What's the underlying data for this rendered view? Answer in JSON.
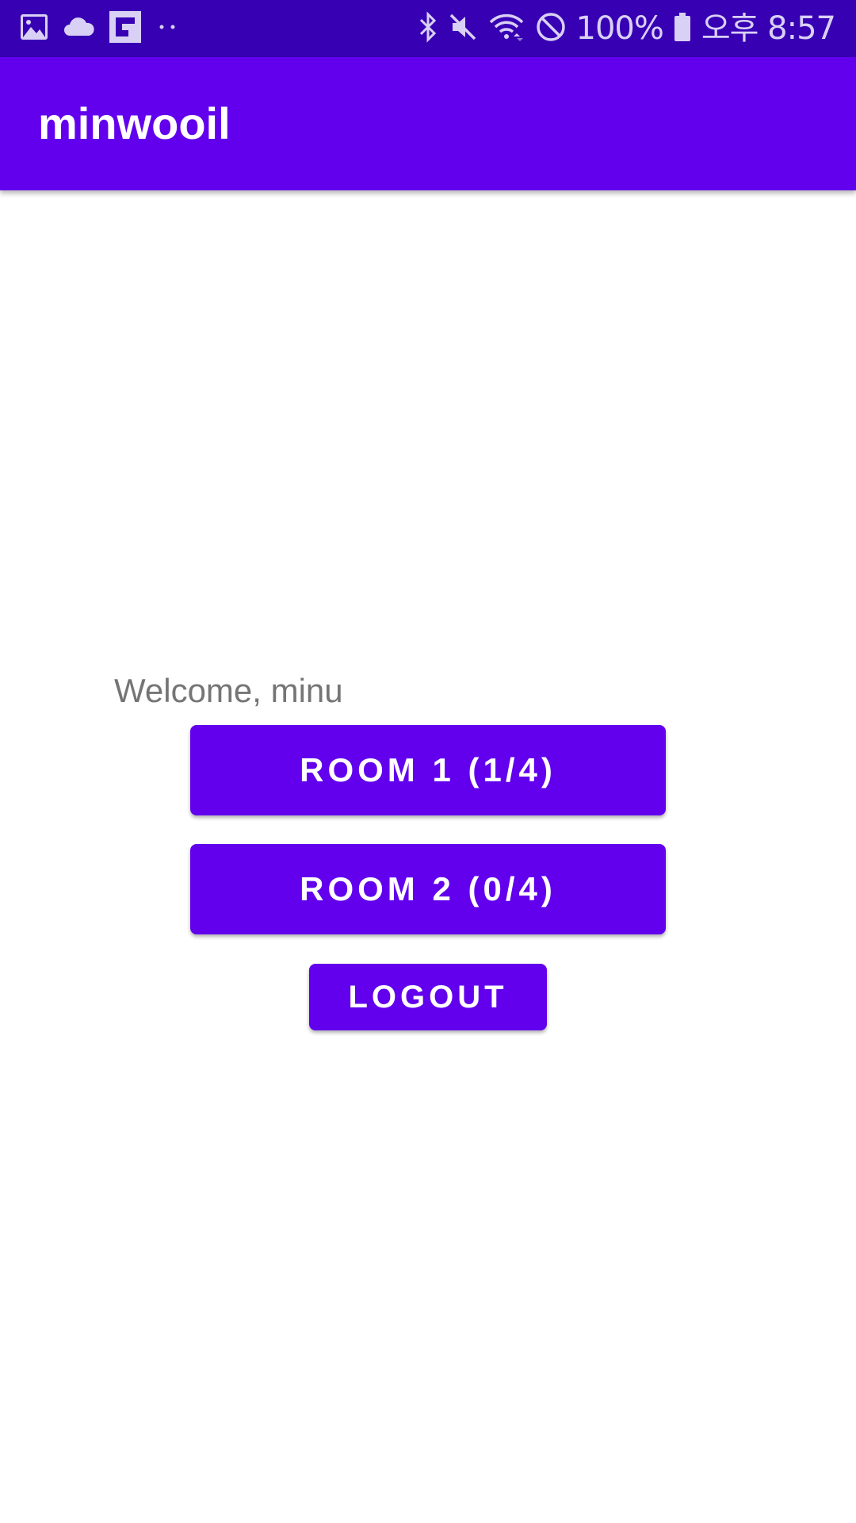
{
  "status_bar": {
    "battery_text": "100%",
    "time": "오후 8:57",
    "left_icons": [
      "image-icon",
      "cloud-icon",
      "flipboard-icon",
      "more-dots-icon"
    ],
    "right_icons": [
      "bluetooth-icon",
      "mute-icon",
      "wifi-icon",
      "do-not-disturb-icon",
      "battery-icon"
    ]
  },
  "app_bar": {
    "title": "minwooil",
    "color": "#6200ee"
  },
  "main": {
    "welcome_text": "Welcome, minu",
    "room1_label": "ROOM 1 (1/4)",
    "room2_label": "ROOM 2 (0/4)",
    "logout_label": "LOGOUT"
  },
  "colors": {
    "primary": "#6200ee",
    "primary_dark": "#3700b3",
    "text_secondary": "#757575"
  }
}
